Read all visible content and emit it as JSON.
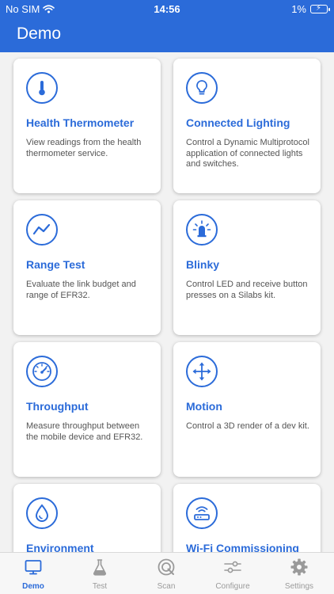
{
  "status": {
    "carrier": "No SIM",
    "time": "14:56",
    "battery": "1%"
  },
  "nav": {
    "title": "Demo"
  },
  "cards": [
    {
      "title": "Health Thermometer",
      "desc": "View readings from the health thermometer service.",
      "icon": "thermometer-icon"
    },
    {
      "title": "Connected Lighting",
      "desc": "Control a Dynamic Multiprotocol application of connected lights and switches.",
      "icon": "lightbulb-icon"
    },
    {
      "title": "Range Test",
      "desc": "Evaluate the link budget and range of EFR32.",
      "icon": "line-chart-icon"
    },
    {
      "title": "Blinky",
      "desc": "Control LED and receive button presses on a Silabs kit.",
      "icon": "led-icon"
    },
    {
      "title": "Throughput",
      "desc": "Measure throughput between the mobile device and EFR32.",
      "icon": "speedometer-icon"
    },
    {
      "title": "Motion",
      "desc": "Control a 3D render of a dev kit.",
      "icon": "move-arrows-icon"
    },
    {
      "title": "Environment",
      "desc": "",
      "icon": "water-drop-icon"
    },
    {
      "title": "Wi-Fi Commissioning",
      "desc": "",
      "icon": "wifi-router-icon"
    }
  ],
  "tabs": [
    {
      "label": "Demo",
      "icon": "demo-screen-icon",
      "active": true
    },
    {
      "label": "Test",
      "icon": "flask-icon",
      "active": false
    },
    {
      "label": "Scan",
      "icon": "scan-icon",
      "active": false
    },
    {
      "label": "Configure",
      "icon": "sliders-icon",
      "active": false
    },
    {
      "label": "Settings",
      "icon": "gear-icon",
      "active": false
    }
  ],
  "colors": {
    "accent": "#2b6bd9",
    "inactive": "#9a9a9a",
    "background": "#f2f2f2"
  }
}
